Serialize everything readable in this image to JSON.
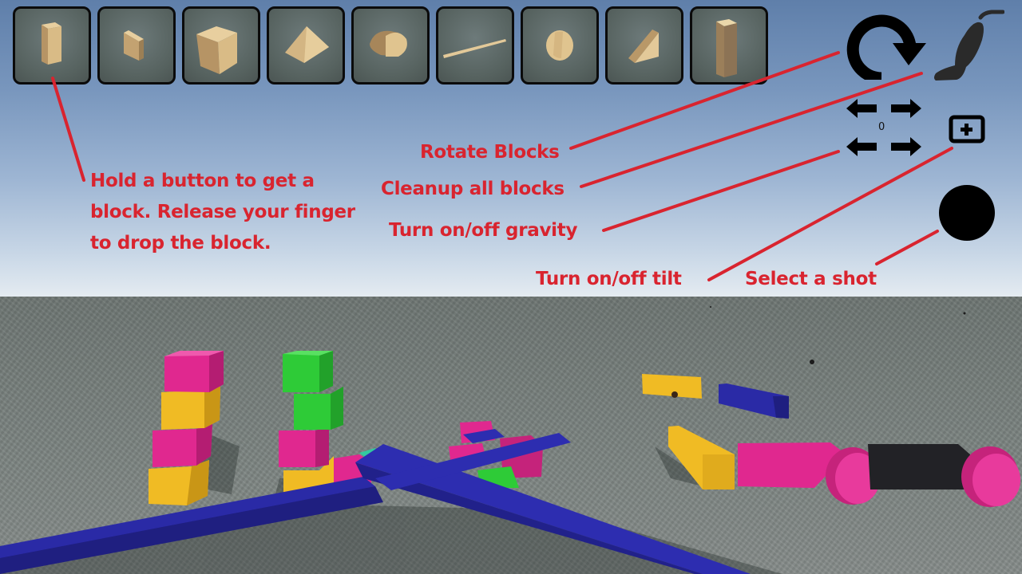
{
  "toolbar": {
    "blocks": [
      {
        "label": "tall-rectangular-block"
      },
      {
        "label": "thin-square-block"
      },
      {
        "label": "cube-block"
      },
      {
        "label": "triangular-prism-block"
      },
      {
        "label": "half-cylinder-block"
      },
      {
        "label": "thin-rod-block"
      },
      {
        "label": "cylinder-block"
      },
      {
        "label": "wedge-block"
      },
      {
        "label": "pillar-block"
      }
    ]
  },
  "controls": {
    "rotate": {
      "icon": "rotate-clockwise-icon"
    },
    "cleanup": {
      "icon": "vacuum-cleaner-icon"
    },
    "gravity": {
      "icon": "gravity-arrows-icon",
      "counter": "0"
    },
    "tilt": {
      "icon": "tilt-toggle-icon"
    },
    "shot": {
      "icon": "shot-ball-icon"
    }
  },
  "annotations": {
    "hold_button": "Hold a button to get a block. Release your finger to drop the block.",
    "rotate": "Rotate Blocks",
    "cleanup": "Cleanup all blocks",
    "gravity": "Turn on/off gravity",
    "tilt": "Turn on/off tilt",
    "shot": "Select a shot"
  },
  "colors": {
    "annotation": "#d9242f",
    "block_pink": "#e0288f",
    "block_yellow": "#f0bb24",
    "block_green": "#2ecb37",
    "block_blue": "#2a2aa6",
    "block_black": "#222226"
  }
}
